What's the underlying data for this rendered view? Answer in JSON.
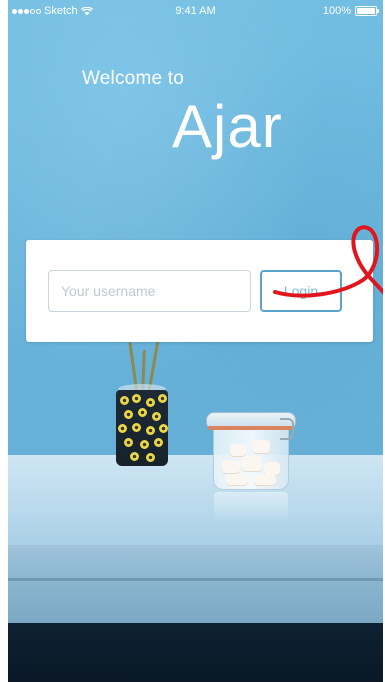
{
  "status_bar": {
    "carrier": "Sketch",
    "time": "9:41 AM",
    "battery": "100%",
    "battery_level": 1.0
  },
  "welcome": {
    "greeting": "Welcome to",
    "app_name": "Ajar"
  },
  "login": {
    "username_placeholder": "Your username",
    "username_value": "",
    "button_label": "Login"
  },
  "colors": {
    "wall": "#6db6dc",
    "button_border": "#5aa3d1",
    "annotation": "#e0161c"
  },
  "icons": {
    "signal": "signal-dots-icon",
    "wifi": "wifi-icon",
    "battery": "battery-icon"
  }
}
